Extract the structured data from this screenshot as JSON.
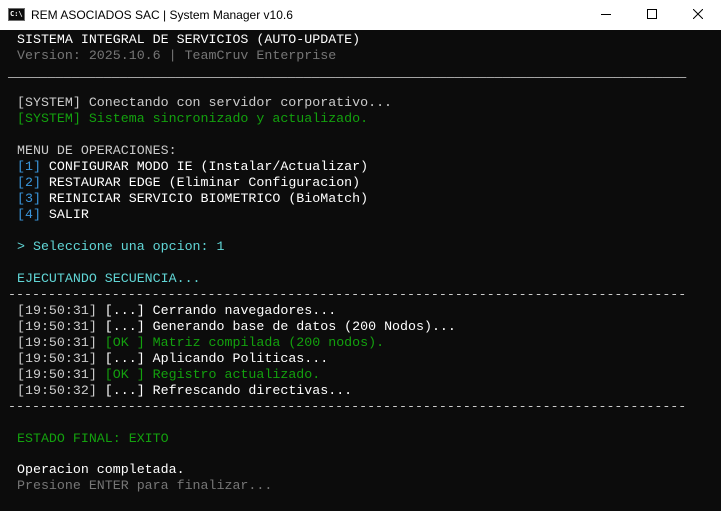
{
  "window": {
    "title": "REM ASOCIADOS SAC | System Manager v10.6",
    "icon": "console-icon",
    "icon_text": "C:\\."
  },
  "console": {
    "header_title": "SISTEMA INTEGRAL DE SERVICIOS (AUTO-UPDATE)",
    "version_line": "Version: 2025.10.6 | TeamCruv Enterprise",
    "separator_double": "_____________________________________________________________________________________",
    "separator_dash": "-------------------------------------------------------------------------------------",
    "log1": "[SYSTEM] Conectando con servidor corporativo...",
    "log2": "[SYSTEM] Sistema sincronizado y actualizado.",
    "menu_header": "MENU DE OPERACIONES:",
    "menu": [
      {
        "key": "[1]",
        "label": " CONFIGURAR MODO IE (Instalar/Actualizar)"
      },
      {
        "key": "[2]",
        "label": " RESTAURAR EDGE (Eliminar Configuracion)"
      },
      {
        "key": "[3]",
        "label": " REINICIAR SERVICIO BIOMETRICO (BioMatch)"
      },
      {
        "key": "[4]",
        "label": " SALIR"
      }
    ],
    "prompt": "> Seleccione una opcion: 1",
    "executing": "EJECUTANDO SECUENCIA...",
    "steps": [
      {
        "time": "[19:50:31]",
        "status": "[...]",
        "message": "Cerrando navegadores..."
      },
      {
        "time": "[19:50:31]",
        "status": "[...]",
        "message": "Generando base de datos (200 Nodos)..."
      },
      {
        "time": "[19:50:31]",
        "status": "[OK ]",
        "message": "Matriz compilada (200 nodos)."
      },
      {
        "time": "[19:50:31]",
        "status": "[...]",
        "message": "Aplicando Politicas..."
      },
      {
        "time": "[19:50:31]",
        "status": "[OK ]",
        "message": "Registro actualizado."
      },
      {
        "time": "[19:50:32]",
        "status": "[...]",
        "message": "Refrescando directivas..."
      }
    ],
    "final_state": "ESTADO FINAL: EXITO",
    "completed": "Operacion completada.",
    "press_enter": "Presione ENTER para finalizar..."
  },
  "colors": {
    "background": "#0c0c0c",
    "text": "#cccccc",
    "success": "#13a10e",
    "info": "#3a96dd",
    "muted": "#767676",
    "prompt": "#61d6d6"
  }
}
